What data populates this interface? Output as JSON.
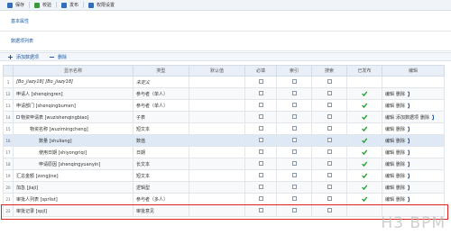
{
  "toolbar": {
    "items": [
      {
        "label": "保存",
        "icon": "save-icon",
        "color": "#2f6fbd"
      },
      {
        "label": "校验",
        "icon": "check-icon",
        "color": "#3a9a3a"
      },
      {
        "label": "发布",
        "icon": "publish-icon",
        "color": "#2f6fbd"
      },
      {
        "label": "权限设置",
        "icon": "permission-icon",
        "color": "#2f6fbd"
      }
    ]
  },
  "sections": {
    "basic": "基本属性",
    "data_items": "数据项列表"
  },
  "subtoolbar": {
    "add_label": "添加数据项",
    "delete_label": "删除"
  },
  "grid": {
    "columns": [
      "",
      "显示名称",
      "类型",
      "默认值",
      "必填",
      "索引",
      "搜索",
      "已发布",
      "编辑"
    ],
    "rows": [
      {
        "num": "1",
        "name": "[Bo_jiazy18]  [Bo_jiazy18]",
        "type": "",
        "placeholder_type": "未定义",
        "default": "",
        "required": false,
        "index": false,
        "search": false,
        "published": false,
        "actions": [],
        "arrows": false,
        "indent": 0,
        "placeholder": true,
        "alt": false,
        "tree": false
      },
      {
        "num": "12",
        "name": "申请人 [shenqingren]",
        "type": "参与者（单人）",
        "default": "",
        "required": false,
        "index": false,
        "search": false,
        "published": true,
        "actions": [
          "编辑",
          "删除"
        ],
        "arrows": true,
        "indent": 0,
        "placeholder": false,
        "alt": true,
        "tree": false
      },
      {
        "num": "13",
        "name": "申请部门 [shenqingbumen]",
        "type": "参与者（单人）",
        "default": "",
        "required": false,
        "index": false,
        "search": false,
        "published": true,
        "actions": [
          "编辑",
          "删除"
        ],
        "arrows": true,
        "indent": 0,
        "placeholder": false,
        "alt": false,
        "tree": false
      },
      {
        "num": "14",
        "name": "物资申请表 [wuzishenqingbiao]",
        "type": "子表",
        "default": "",
        "required": false,
        "index": false,
        "search": false,
        "published": true,
        "actions": [
          "编辑",
          "添加数据项",
          "删除"
        ],
        "arrows": true,
        "indent": 0,
        "placeholder": false,
        "alt": true,
        "tree": true
      },
      {
        "num": "15",
        "name": "物资名称 [wuzimingcheng]",
        "type": "短文本",
        "default": "",
        "required": false,
        "index": false,
        "search": false,
        "published": true,
        "actions": [
          "编辑",
          "删除"
        ],
        "arrows": true,
        "indent": 1,
        "placeholder": false,
        "alt": false,
        "tree": false
      },
      {
        "num": "16",
        "name": "数量 [shuliang]",
        "type": "数值",
        "default": "",
        "required": false,
        "index": false,
        "search": false,
        "published": true,
        "actions": [
          "编辑",
          "删除"
        ],
        "arrows": true,
        "indent": 2,
        "placeholder": false,
        "alt": true,
        "sel": true,
        "tree": false
      },
      {
        "num": "17",
        "name": "使用日期 [shiyongriqi]",
        "type": "日期",
        "default": "",
        "required": false,
        "index": false,
        "search": false,
        "published": true,
        "actions": [
          "编辑",
          "删除"
        ],
        "arrows": true,
        "indent": 2,
        "placeholder": false,
        "alt": false,
        "tree": false
      },
      {
        "num": "18",
        "name": "申请原因 [shenqingyuanyin]",
        "type": "长文本",
        "default": "",
        "required": false,
        "index": false,
        "search": false,
        "published": true,
        "actions": [
          "编辑",
          "删除"
        ],
        "arrows": true,
        "indent": 2,
        "placeholder": false,
        "alt": true,
        "tree": false
      },
      {
        "num": "19",
        "name": "汇总金额 [zongjine]",
        "type": "短文本",
        "default": "",
        "required": false,
        "index": false,
        "search": false,
        "published": true,
        "actions": [
          "编辑",
          "删除"
        ],
        "arrows": true,
        "indent": 0,
        "placeholder": false,
        "alt": false,
        "tree": false
      },
      {
        "num": "20",
        "name": "加急 [jiaji]",
        "type": "逻辑型",
        "default": "",
        "required": false,
        "index": false,
        "search": false,
        "published": true,
        "actions": [
          "编辑",
          "删除"
        ],
        "arrows": true,
        "indent": 0,
        "placeholder": false,
        "alt": true,
        "tree": false
      },
      {
        "num": "21",
        "name": "审批人列表 [sprlist]",
        "type": "参与者（多人）",
        "default": "",
        "required": false,
        "index": false,
        "search": false,
        "published": true,
        "actions": [
          "编辑",
          "删除"
        ],
        "arrows": true,
        "indent": 0,
        "placeholder": false,
        "alt": false,
        "tree": false
      },
      {
        "num": "22",
        "name": "审批记录 [spjl]",
        "type": "审批意见",
        "default": "",
        "required": false,
        "index": false,
        "search": false,
        "published": false,
        "actions": [],
        "arrows": false,
        "indent": 0,
        "placeholder": false,
        "alt": true,
        "tree": false
      }
    ]
  },
  "watermark": "H3 BPM",
  "colors": {
    "accent": "#1d5aa6",
    "check": "#1e9c2e",
    "highlight": "#e02020"
  }
}
